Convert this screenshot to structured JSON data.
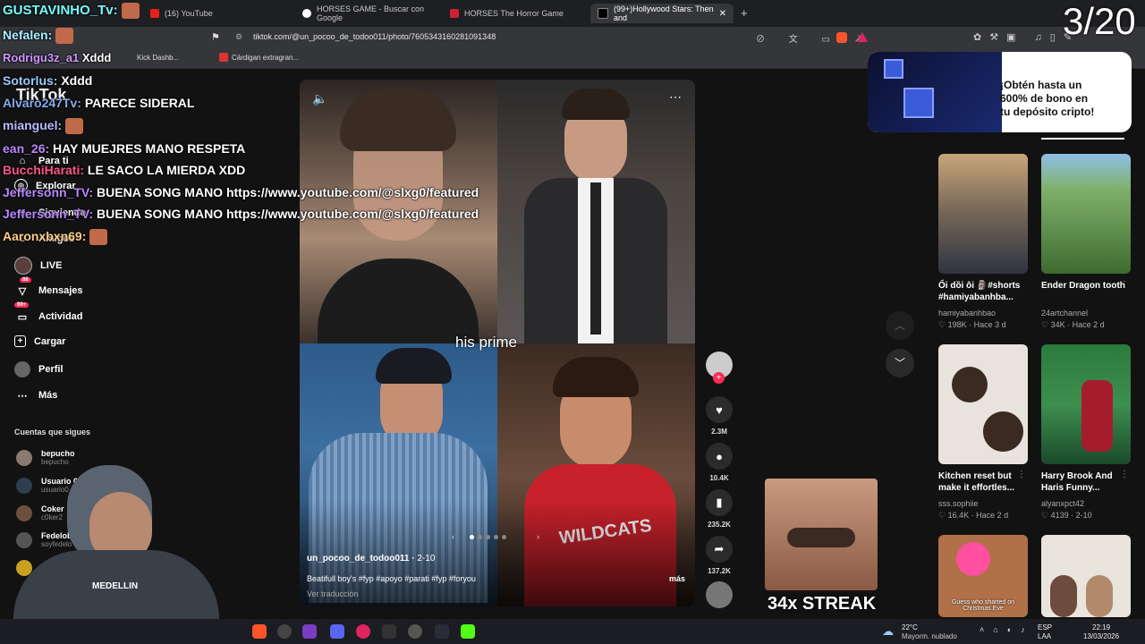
{
  "browser": {
    "tabs": [
      {
        "label": "GUSTAVINHO_Tv:"
      },
      {
        "label": "(16) YouTube"
      },
      {
        "label": "HORSES GAME - Buscar con Google"
      },
      {
        "label": "HORSES The Horror Game"
      },
      {
        "label": "(99+)Hollywood Stars: Then and"
      }
    ],
    "new_tab": "+",
    "url": "tiktok.com/@un_pocoo_de_todoo011/photo/7605343160281091348",
    "bookmarks": [
      "Kick Dashb...",
      "Cárdigan extragran..."
    ]
  },
  "counter": "3/20",
  "sidebar": {
    "logo": "TikTok",
    "items": [
      {
        "label": "Para ti"
      },
      {
        "label": "Explorar"
      },
      {
        "label": "Siguiendo"
      },
      {
        "label": "Amigos"
      },
      {
        "label": "LIVE"
      },
      {
        "label": "Mensajes",
        "badge": "88"
      },
      {
        "label": "Actividad",
        "badge": "99+"
      },
      {
        "label": "Cargar"
      },
      {
        "label": "Perfil"
      },
      {
        "label": "Más"
      }
    ],
    "following_title": "Cuentas que sigues",
    "following": [
      {
        "name": "bepucho",
        "handle": "bepucho"
      },
      {
        "name": "Usuario 0",
        "handle": "usuario0"
      },
      {
        "name": "Coker",
        "handle": "c0ker2"
      },
      {
        "name": "Fedelobo",
        "handle": "soyfedelo"
      }
    ]
  },
  "post": {
    "caption_overlay": "his prime",
    "author": "un_pocoo_de_todoo011",
    "date": "2-10",
    "description": "Beatifull boy's #fyp #apoyo #parati #fyp #foryou",
    "more": "más",
    "translate": "Ver traducción",
    "likes": "2.3M",
    "comments": "10.4K",
    "saves": "235.2K",
    "shares": "137.2K"
  },
  "ad": {
    "text": "¡Obtén hasta un 600% de bono en tu depósito cripto!"
  },
  "recommended": [
    {
      "title": "Ối dồi ôi 🗿#shorts #hamiyabanhba...",
      "author": "hamiyabanhbao",
      "likes": "198K",
      "age": "Hace 3 d"
    },
    {
      "title": "Ender Dragon tooth",
      "author": "24artchannel",
      "likes": "34K",
      "age": "Hace 2 d"
    },
    {
      "title": "Kitchen reset but make it effortles...",
      "author": "sss.sophiie",
      "likes": "16.4K",
      "age": "Hace 2 d"
    },
    {
      "title": "Harry Brook And Haris Funny...",
      "author": "alyanxpct42",
      "likes": "4139",
      "age": "2-10"
    },
    {
      "title": "Guess who sharted on Christmas Eve",
      "author": "",
      "likes": "",
      "age": ""
    },
    {
      "title": "",
      "author": "",
      "likes": "",
      "age": ""
    }
  ],
  "chat": [
    {
      "user": "GUSTAVINHO_Tv:",
      "msg": ""
    },
    {
      "user": "Nefalen:",
      "msg": ""
    },
    {
      "user": "Rodrigu3z_a1",
      "msg": "Xddd"
    },
    {
      "user": "Sotorlus:",
      "msg": "Xddd"
    },
    {
      "user": "Alvaro247Tv:",
      "msg": "PARECE SIDERAL"
    },
    {
      "user": "mianguel:",
      "msg": ""
    },
    {
      "user": "ean_26:",
      "msg": "HAY MUEJRES MANO RESPETA"
    },
    {
      "user": "BucchiHarati:",
      "msg": "LE SACO LA MIERDA XDD"
    },
    {
      "user": "Jeffersonn_TV:",
      "msg": "BUENA SONG MANO https://www.youtube.com/@slxg0/featured"
    },
    {
      "user": "Jeffersonn_TV:",
      "msg": "BUENA SONG MANO https://www.youtube.com/@slxg0/featured"
    },
    {
      "user": "Aaronxbxn69:",
      "msg": ""
    }
  ],
  "streak": "34x STREAK",
  "taskbar": {
    "weather_temp": "22°C",
    "weather_desc": "Mayorm. nublado",
    "lang1": "ESP",
    "lang2": "LAA",
    "time": "22:19",
    "date": "13/03/2026"
  }
}
